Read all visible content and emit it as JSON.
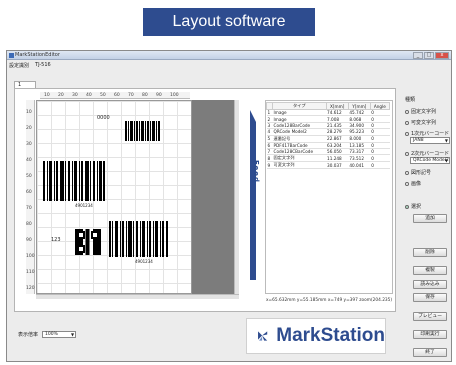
{
  "banner": {
    "title": "Layout software"
  },
  "window": {
    "title": "MarkStationEditor",
    "minimize": "_",
    "maximize": "□",
    "close": "x"
  },
  "toprow": {
    "label": "設定識別",
    "value": "TJ-516"
  },
  "tab": {
    "label": "1"
  },
  "ruler": {
    "top": [
      "10",
      "20",
      "30",
      "40",
      "50",
      "60",
      "70",
      "80",
      "90",
      "100"
    ],
    "left": [
      "10",
      "20",
      "30",
      "40",
      "50",
      "60",
      "70",
      "80",
      "90",
      "100",
      "110",
      "120"
    ]
  },
  "canvas": {
    "text_item": "0000",
    "small_caption1": "4901234",
    "small_caption2": "123",
    "small_caption3": "4901234"
  },
  "feed": {
    "label": "Feed"
  },
  "table": {
    "headers": [
      "",
      "タイプ",
      "X[mm]",
      "Y[mm]",
      "Angle"
    ],
    "rows": [
      [
        "1",
        "Image",
        "74.612",
        "45.742",
        "0"
      ],
      [
        "2",
        "Image",
        "7.008",
        "8.068",
        "0"
      ],
      [
        "3",
        "Code128BarCode",
        "21.435",
        "34.900",
        "0"
      ],
      [
        "4",
        "QRCode Model2",
        "28.279",
        "95.223",
        "0"
      ],
      [
        "5",
        "連番記号",
        "22.867",
        "8.000",
        "0"
      ],
      [
        "6",
        "PDF417BarCode",
        "63.204",
        "13.185",
        "0"
      ],
      [
        "7",
        "Code128CBarCode",
        "56.050",
        "73.317",
        "0"
      ],
      [
        "8",
        "固定文字列",
        "11.248",
        "73.512",
        "0"
      ],
      [
        "9",
        "可変文字列",
        "30.037",
        "40.041",
        "0"
      ]
    ]
  },
  "coords": {
    "text": "x=65.632mm y=55.185mm x=749 y=397 zoom(204.235)"
  },
  "right_panel": {
    "heading": "種類",
    "options": [
      "固定文字列",
      "可変文字列",
      "1次元バーコード",
      "2次元バーコード",
      "図形記号",
      "画像"
    ],
    "select1": "JAN8",
    "select2": "QRCode Model2",
    "radio_selected": "選択",
    "buttons": [
      "追加",
      "削除",
      "複製",
      "読み込み",
      "保存",
      "プレビュー",
      "印刷実行",
      "終了"
    ]
  },
  "bottomleft": {
    "label": "表示倍率",
    "value": "100%"
  },
  "logo": {
    "text": "MarkStation",
    "icon": "markstation-logo-icon"
  },
  "colors": {
    "banner": "#2e4c8f",
    "logo": "#2e4c8f"
  }
}
